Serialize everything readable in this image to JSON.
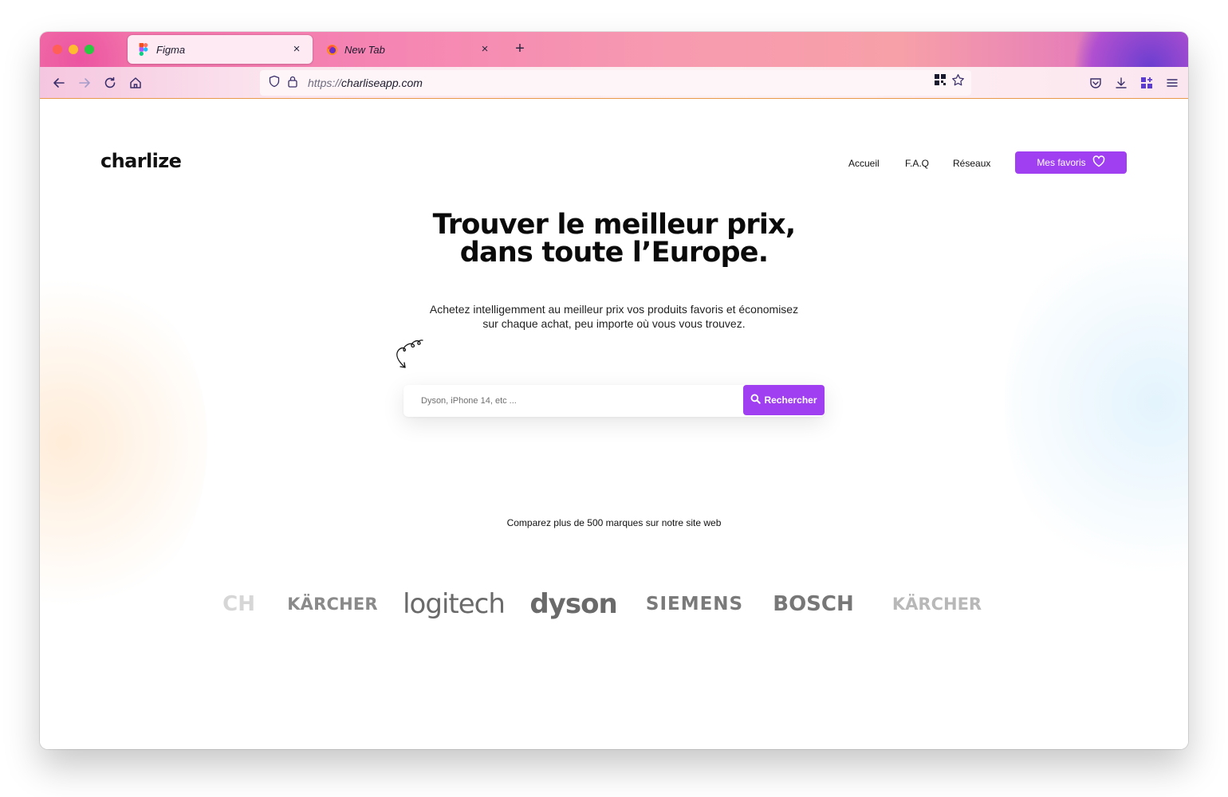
{
  "browser": {
    "tabs": [
      {
        "title": "Figma",
        "icon": "figma-icon",
        "active": true
      },
      {
        "title": "New Tab",
        "icon": "firefox-icon",
        "active": false
      }
    ],
    "close_glyph": "×",
    "new_tab_glyph": "+",
    "url": {
      "scheme": "https://",
      "host": "charliseapp.com"
    }
  },
  "site": {
    "logo": "charlize",
    "nav": [
      "Accueil",
      "F.A.Q",
      "Réseaux"
    ],
    "favorites_button": "Mes favoris",
    "hero": {
      "title_line1": "Trouver le meilleur prix,",
      "title_line2": "dans toute l’Europe.",
      "subtitle_line1": "Achetez intelligemment au meilleur prix vos produits favoris et économisez",
      "subtitle_line2": "sur chaque achat, peu importe où vous vous trouvez."
    },
    "search": {
      "placeholder": "Dyson, iPhone 14, etc ...",
      "button": "Rechercher"
    },
    "compare_text": "Comparez plus de 500 marques sur notre site web",
    "brands": [
      "CH",
      "KÄRCHER",
      "logitech",
      "dyson",
      "SIEMENS",
      "BOSCH",
      "KÄRCHER"
    ]
  },
  "colors": {
    "accent": "#a03ff2",
    "text": "#111111",
    "brand_gray": "#6e6e6e"
  }
}
